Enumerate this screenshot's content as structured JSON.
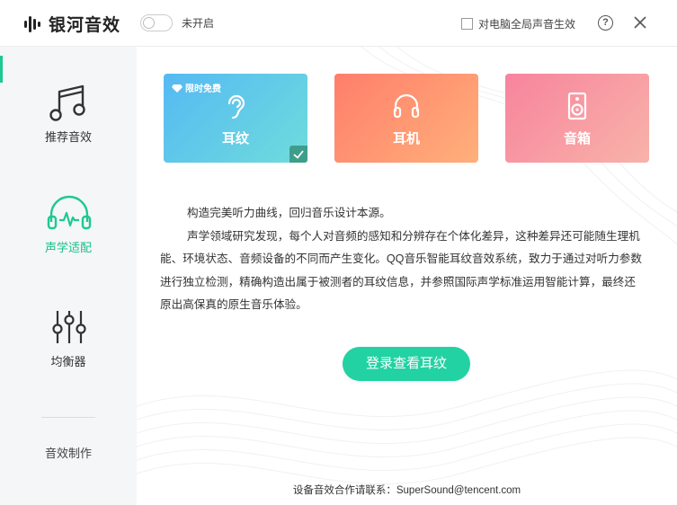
{
  "app": {
    "title": "银河音效"
  },
  "titlebar": {
    "toggle_label": "未开启",
    "toggle_on": false,
    "global_effect_label": "对电脑全局声音生效",
    "global_effect_checked": false,
    "help_icon": "?",
    "close_icon": "close-icon"
  },
  "sidebar": {
    "items": [
      {
        "label": "推荐音效",
        "icon": "music-note-icon",
        "active": false
      },
      {
        "label": "声学适配",
        "icon": "headphone-wave-icon",
        "active": true
      },
      {
        "label": "均衡器",
        "icon": "equalizer-icon",
        "active": false
      }
    ],
    "bottom_label": "音效制作"
  },
  "cards": [
    {
      "label": "耳纹",
      "icon": "ear-icon",
      "badge": "限时免费",
      "selected": true
    },
    {
      "label": "耳机",
      "icon": "headphone-icon",
      "selected": false
    },
    {
      "label": "音箱",
      "icon": "speaker-icon",
      "selected": false
    }
  ],
  "description": {
    "p1": "构造完美听力曲线，回归音乐设计本源。",
    "p2": "声学领域研究发现，每个人对音频的感知和分辨存在个体化差异，这种差异还可能随生理机能、环境状态、音频设备的不同而产生变化。QQ音乐智能耳纹音效系统，致力于通过对听力参数进行独立检测，精确构造出属于被测者的耳纹信息，并参照国际声学标准运用智能计算，最终还原出高保真的原生音乐体验。"
  },
  "login_button": "登录查看耳纹",
  "contact": "设备音效合作请联系：SuperSound@tencent.com",
  "colors": {
    "accent": "#1ec98f",
    "button": "#22d2a3"
  }
}
